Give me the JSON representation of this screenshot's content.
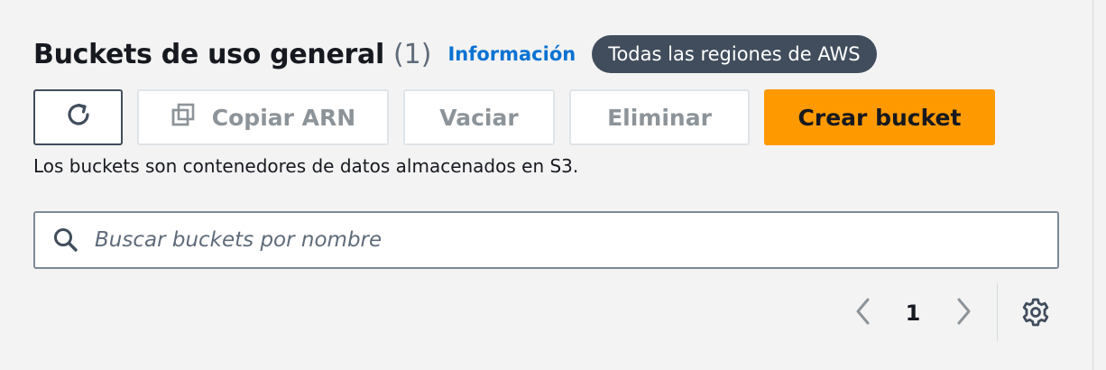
{
  "header": {
    "title": "Buckets de uso general",
    "count": "(1)",
    "info_link": "Información",
    "region_badge": "Todas las regiones de AWS"
  },
  "toolbar": {
    "refresh_icon": "refresh-icon",
    "copy_icon": "copy-icon",
    "copy_arn_label": "Copiar ARN",
    "empty_label": "Vaciar",
    "delete_label": "Eliminar",
    "create_label": "Crear bucket"
  },
  "description": "Los buckets son contenedores de datos almacenados en S3.",
  "search": {
    "icon": "search-icon",
    "placeholder": "Buscar buckets por nombre",
    "value": ""
  },
  "pagination": {
    "prev_icon": "chevron-left-icon",
    "current_page": "1",
    "next_icon": "chevron-right-icon",
    "settings_icon": "gear-icon"
  },
  "colors": {
    "primary_button": "#ff9900",
    "link": "#0972d3",
    "badge_background": "#414d5c",
    "page_background": "#f3f3f3",
    "disabled_text": "#8d9499"
  }
}
